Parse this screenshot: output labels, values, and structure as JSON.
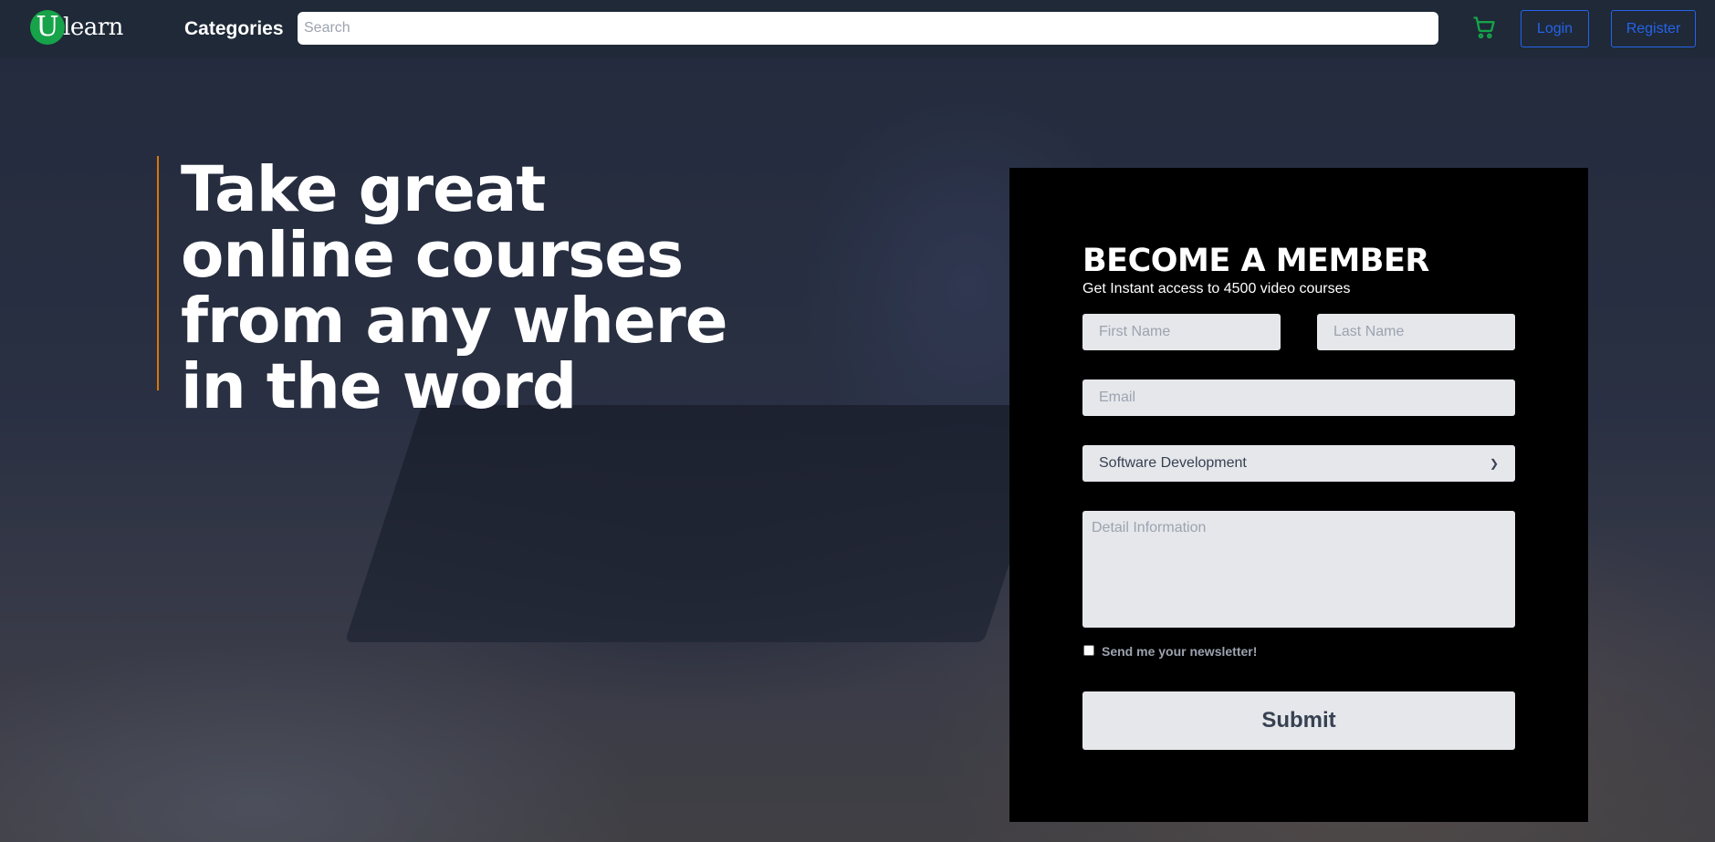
{
  "nav": {
    "logo_letter": "U",
    "logo_text": "learn",
    "categories_label": "Categories",
    "search_placeholder": "Search",
    "cart_icon": "cart-icon",
    "login_label": "Login",
    "register_label": "Register"
  },
  "hero": {
    "headline_lines": [
      "Take great",
      "online courses",
      "from any where",
      "in the word"
    ]
  },
  "form": {
    "title": "BECOME A MEMBER",
    "subtitle": "Get Instant access to 4500 video courses",
    "first_name_placeholder": "First Name",
    "last_name_placeholder": "Last Name",
    "email_placeholder": "Email",
    "select_value": "Software Development",
    "detail_placeholder": "Detail Information",
    "newsletter_label": "Send me your newsletter!",
    "submit_label": "Submit"
  },
  "colors": {
    "nav_bg": "#1f2937",
    "logo_green": "#16a34a",
    "link_blue": "#2563eb",
    "accent_orange": "#d97706",
    "panel_bg": "#000000",
    "field_bg": "#e5e7eb"
  }
}
